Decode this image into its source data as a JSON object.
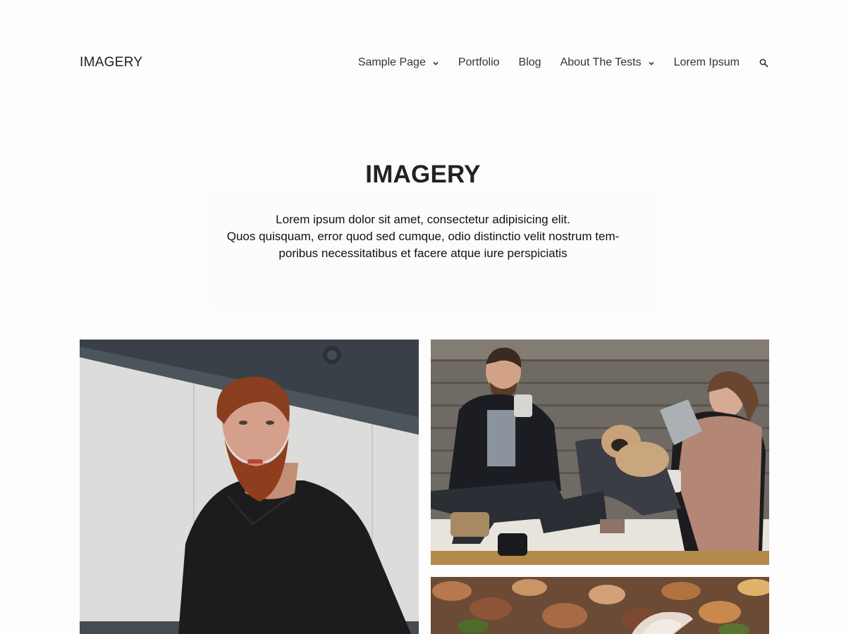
{
  "header": {
    "site_title": "IMAGERY",
    "nav": [
      {
        "label": "Sample Page",
        "has_dropdown": true
      },
      {
        "label": "Portfolio",
        "has_dropdown": false
      },
      {
        "label": "Blog",
        "has_dropdown": false
      },
      {
        "label": "About The Tests",
        "has_dropdown": true
      },
      {
        "label": "Lorem Ipsum",
        "has_dropdown": false
      }
    ],
    "search_icon": "search-icon"
  },
  "main": {
    "title": "IMAGERY",
    "intro_lines": [
      "Lorem ipsum dolor sit amet, consectetur adipisicing elit.",
      "Quos quisquam, error quod sed cumque, odio distinctio velit nostrum tem-",
      "poribus necessitatibus et facere atque iure perspiciatis"
    ]
  },
  "gallery": [
    {
      "subject": "bearded-man-portrait"
    },
    {
      "subject": "couple-with-pug"
    },
    {
      "subject": "autumn-leaves"
    }
  ],
  "colors": {
    "background": "#fdfdfd",
    "text": "#222222",
    "nav_text": "#333333"
  }
}
